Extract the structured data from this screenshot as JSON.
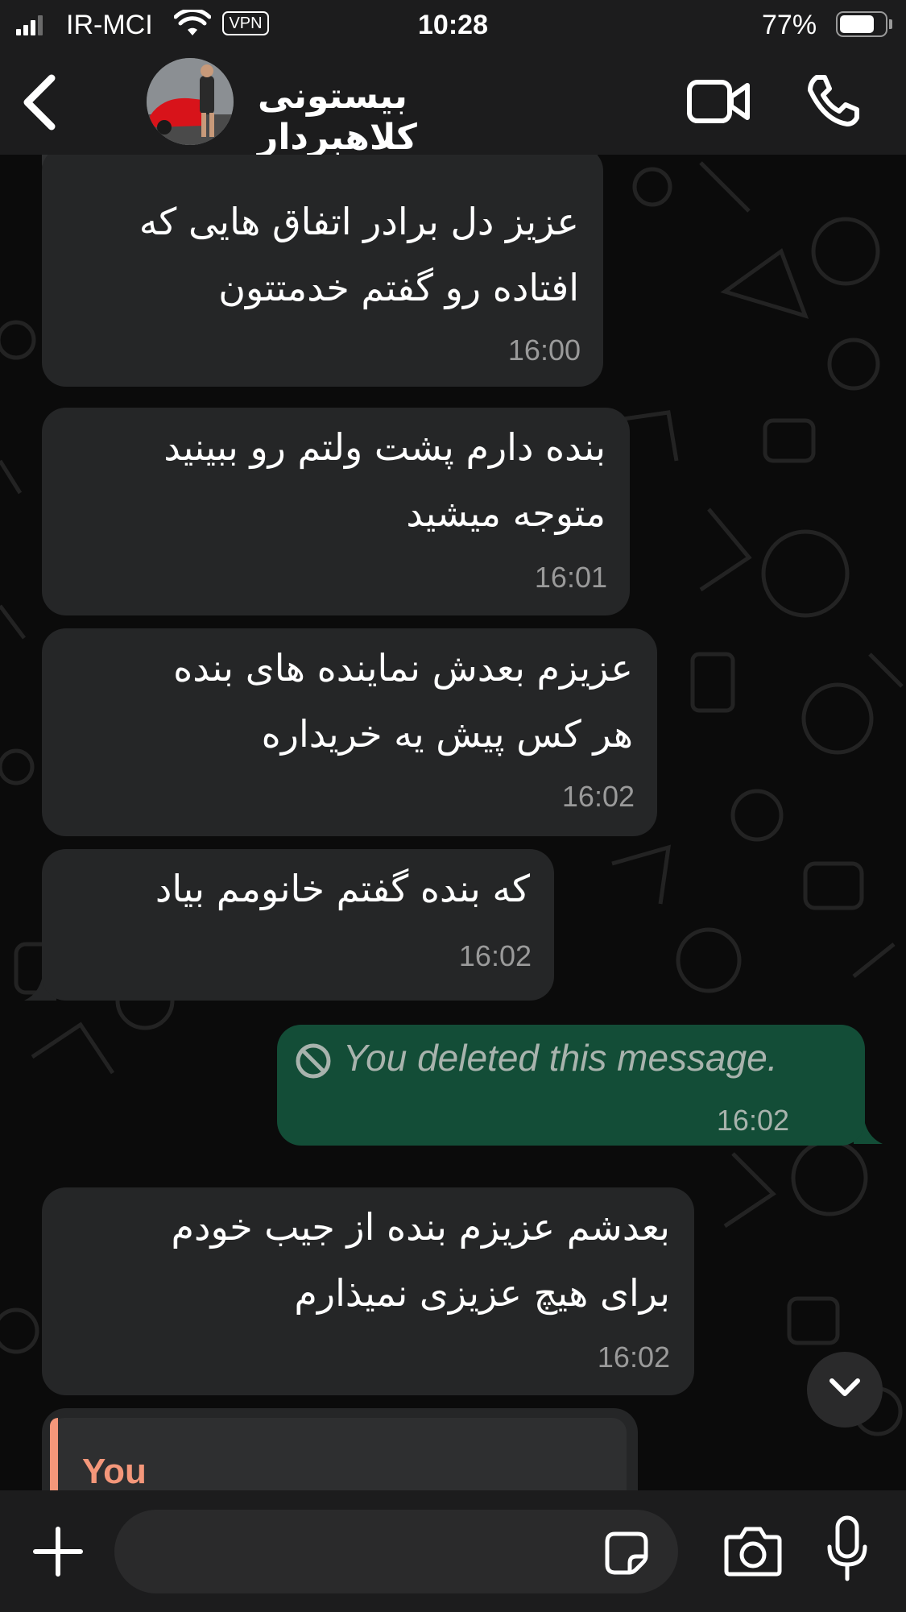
{
  "status_bar": {
    "carrier": "IR-MCI",
    "vpn": "VPN",
    "time": "10:28",
    "battery": "77%",
    "battery_level": 0.77
  },
  "header": {
    "contact_name": "بیستونی کلاهبردار",
    "back_icon": "chevron-left-icon",
    "video_icon": "video-camera-icon",
    "call_icon": "phone-icon"
  },
  "messages": [
    {
      "direction": "in",
      "lines": [
        "عزیز دل برادر اتفاق هایی که",
        "افتاده رو گفتم خدمتتون"
      ],
      "time": "16:00"
    },
    {
      "direction": "in",
      "lines": [
        "بنده دارم پشت ولتم رو ببینید",
        "متوجه میشید"
      ],
      "time": "16:01"
    },
    {
      "direction": "in",
      "lines": [
        "عزیزم بعدش نماینده های بنده",
        "هر کس پیش یه خریداره"
      ],
      "time": "16:02"
    },
    {
      "direction": "in",
      "lines": [
        "که بنده گفتم خانومم بیاد"
      ],
      "time": "16:02"
    },
    {
      "direction": "out",
      "text": "You deleted this message.",
      "time": "16:02"
    },
    {
      "direction": "in",
      "lines": [
        "بعدشم عزیزم بنده از جیب خودم",
        "برای هیچ عزیزی نمیذارم"
      ],
      "time": "16:02"
    }
  ],
  "reply_preview": {
    "sender": "You"
  },
  "input_bar": {
    "text": "",
    "plus_icon": "plus-icon",
    "sticker_icon": "sticker-icon",
    "camera_icon": "camera-icon",
    "mic_icon": "microphone-icon"
  },
  "colors": {
    "bar_bg": "#1c1c1d",
    "incoming_bubble": "#252627",
    "outgoing_bubble": "#134d37",
    "reply_accent": "#f4977a"
  }
}
